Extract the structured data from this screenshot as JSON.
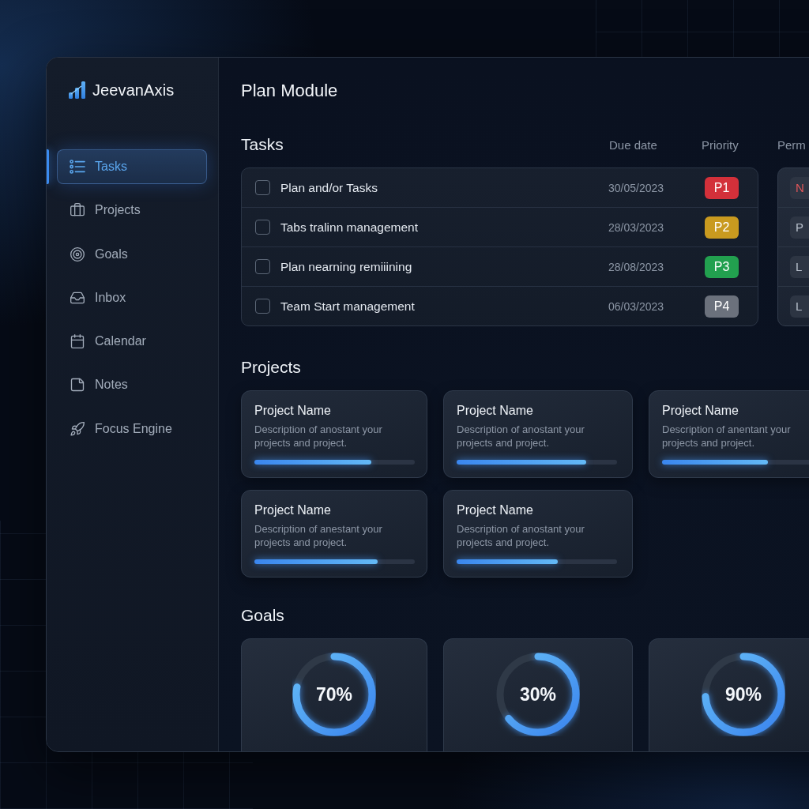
{
  "brand": {
    "name": "JeevanAxis"
  },
  "sidebar": {
    "items": [
      {
        "label": "Tasks",
        "selected": true
      },
      {
        "label": "Projects",
        "selected": false
      },
      {
        "label": "Goals",
        "selected": false
      },
      {
        "label": "Inbox",
        "selected": false
      },
      {
        "label": "Calendar",
        "selected": false
      },
      {
        "label": "Notes",
        "selected": false
      },
      {
        "label": "Focus Engine",
        "selected": false
      }
    ]
  },
  "page": {
    "title": "Plan Module"
  },
  "tasks": {
    "title": "Tasks",
    "columns": [
      "Due date",
      "Priority",
      "Perm"
    ],
    "rows": [
      {
        "name": "Plan and/or Tasks",
        "checked": false,
        "due_date": "30/05/2023",
        "priority": "P1",
        "color": "#d3303a",
        "column_3": {
          "text": "N",
          "color": "#e0575a"
        }
      },
      {
        "name": "Tabs tralinn management",
        "checked": false,
        "due_date": "28/03/2023",
        "priority": "P2",
        "color": "#c99a1f",
        "column_3": {
          "text": "P",
          "color": "#b8c0cc"
        }
      },
      {
        "name": "Plan nearning remiiining",
        "checked": false,
        "due_date": "28/08/2023",
        "priority": "P3",
        "color": "#22a04f",
        "column_3": {
          "text": "L",
          "color": "#b8c0cc"
        }
      },
      {
        "name": "Team Start management",
        "checked": false,
        "due_date": "06/03/2023",
        "priority": "P4",
        "color": "#6b717c",
        "column_3": {
          "text": "L",
          "color": "#b8c0cc"
        }
      }
    ]
  },
  "projects": {
    "title": "Projects",
    "items": [
      {
        "name": "Project Name",
        "description": "Description of anostant your projects and project.",
        "level": 0.73
      },
      {
        "name": "Project Name",
        "description": "Description of anostant your projects and project.",
        "level": 0.81
      },
      {
        "name": "Project Name",
        "description": "Description of anentant your projects and project.",
        "level": 0.66
      },
      {
        "name": "Project Name",
        "description": "Description of anestant your projects and project.",
        "level": 0.77
      },
      {
        "name": "Project Name",
        "description": "Description of anostant your projects and project.",
        "level": 0.63
      }
    ]
  },
  "goals": {
    "title": "Goals",
    "items": [
      {
        "reading": "70%",
        "level": 0.78
      },
      {
        "reading": "30%",
        "level": 0.64
      },
      {
        "reading": "90%",
        "level": 0.74
      }
    ]
  }
}
